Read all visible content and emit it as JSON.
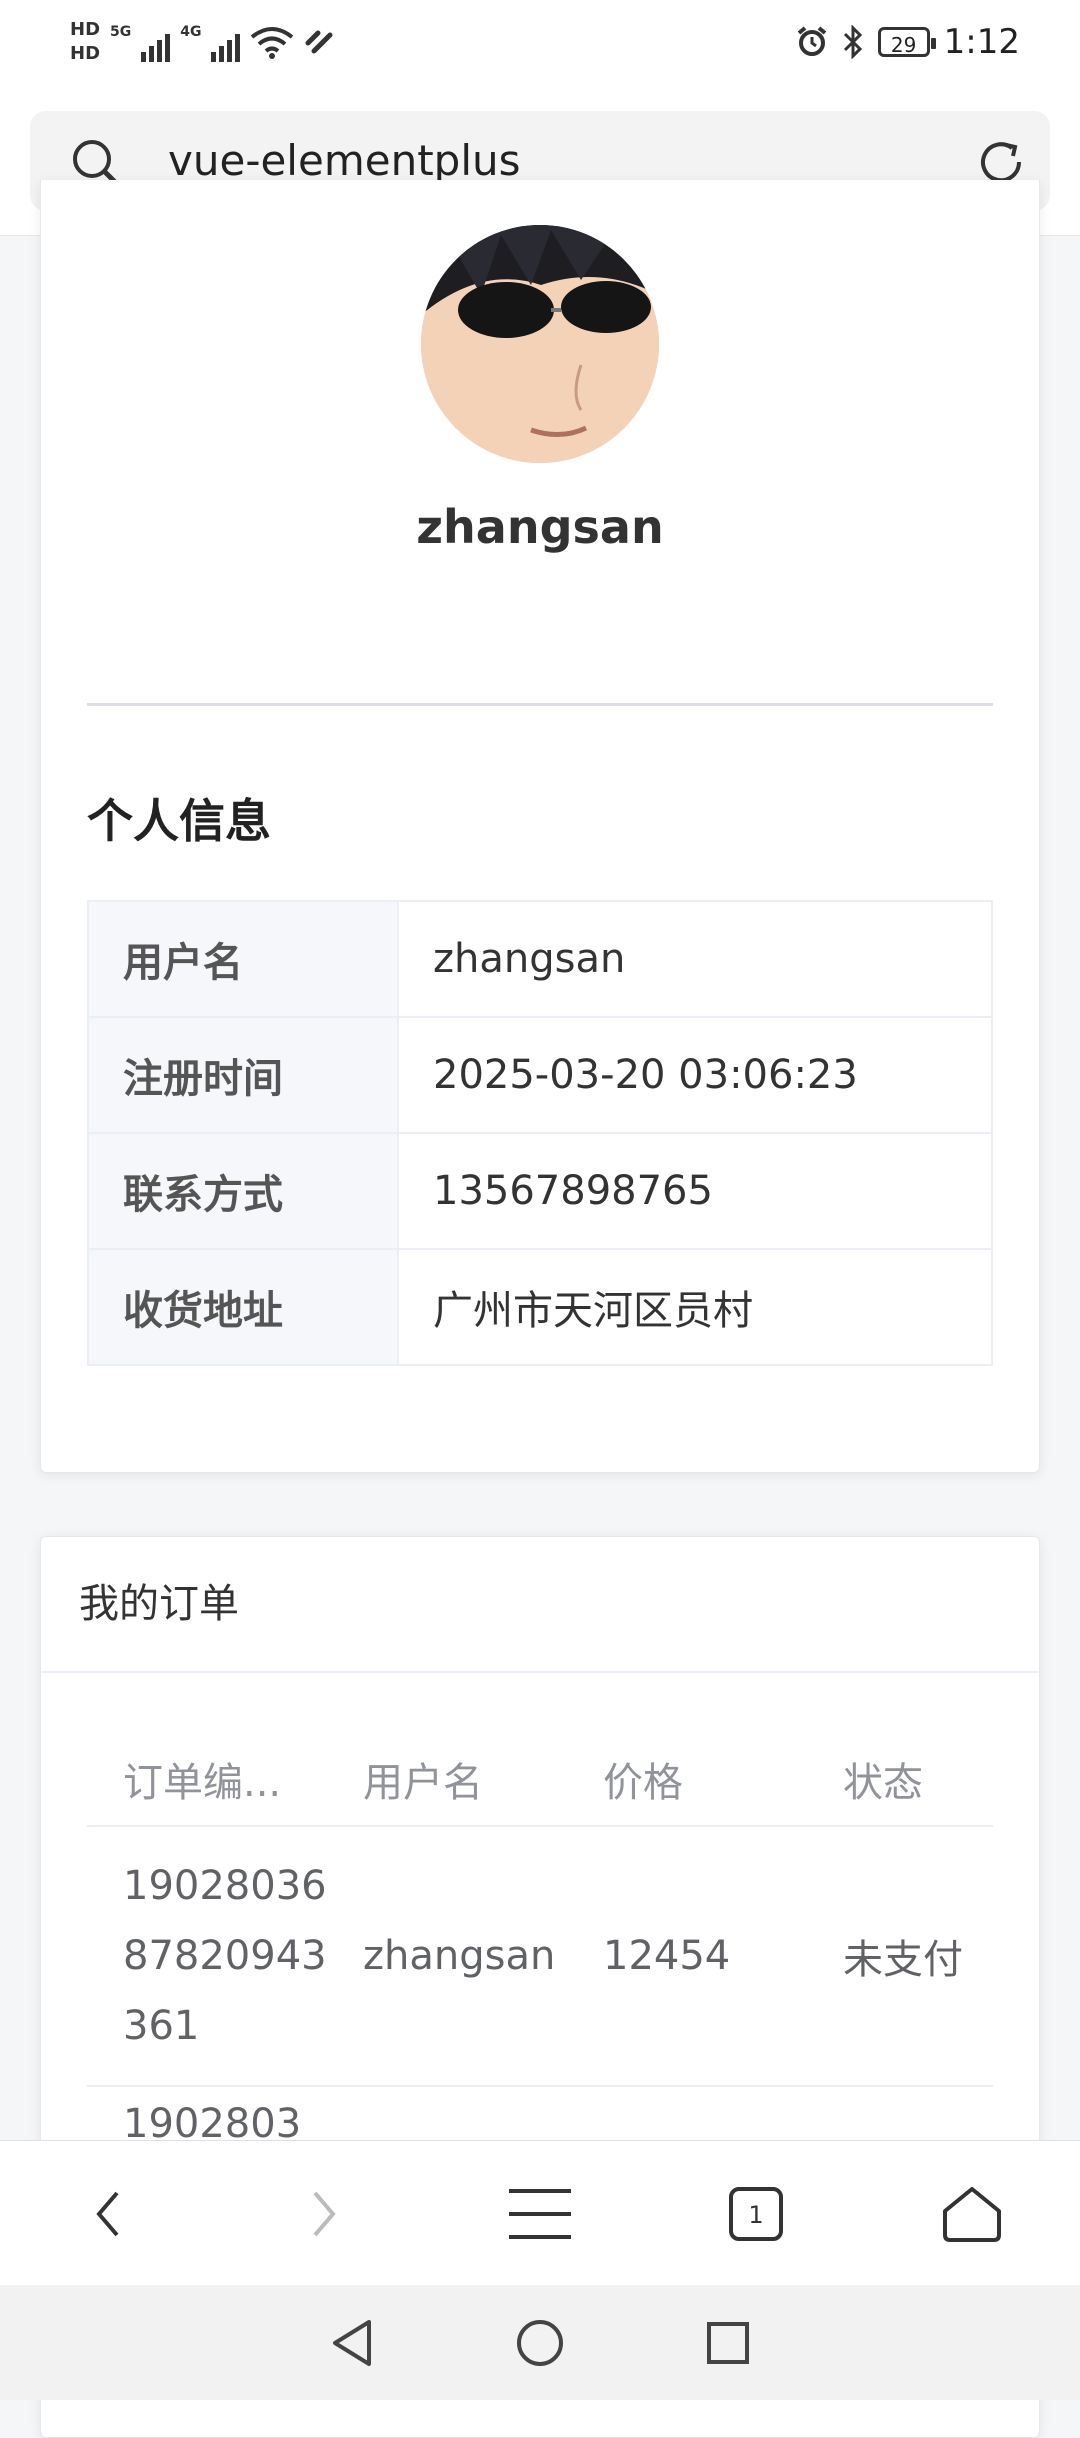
{
  "status_bar": {
    "hd1": "HD",
    "hd2": "HD",
    "net1": "5G",
    "net2": "4G",
    "battery": "29",
    "time": "1:12"
  },
  "url_bar": {
    "text": "vue-elementplus"
  },
  "profile": {
    "username": "zhangsan",
    "section_title": "个人信息",
    "rows": [
      {
        "label": "用户名",
        "value": "zhangsan"
      },
      {
        "label": "注册时间",
        "value": "2025-03-20 03:06:23"
      },
      {
        "label": "联系方式",
        "value": "13567898765"
      },
      {
        "label": "收货地址",
        "value": "广州市天河区员村"
      }
    ]
  },
  "orders": {
    "title": "我的订单",
    "columns": [
      "订单编...",
      "用户名",
      "价格",
      "状态"
    ],
    "rows": [
      {
        "id": "190280368782094336​1",
        "user": "zhangsan",
        "price": "12454",
        "status": "未支付"
      }
    ],
    "partial_row_id": "1902803"
  },
  "browser_nav": {
    "tab_count": "1"
  },
  "icons": [
    "search-icon",
    "reload-icon",
    "back-icon",
    "forward-icon",
    "menu-icon",
    "tabs-icon",
    "home-icon",
    "sys-back-icon",
    "sys-home-icon",
    "sys-recents-icon"
  ]
}
